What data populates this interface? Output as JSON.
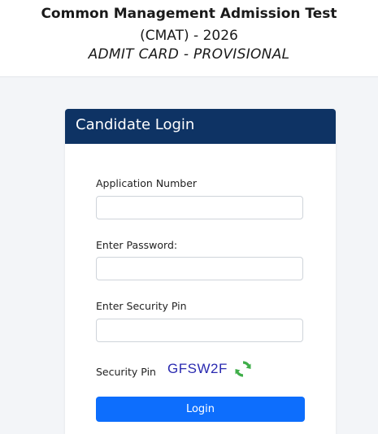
{
  "header": {
    "title": "Common Management Admission Test",
    "subtitle": "(CMAT) - 2026",
    "doc_type": "ADMIT CARD - PROVISIONAL"
  },
  "login": {
    "heading": "Candidate Login",
    "application_label": "Application Number",
    "application_value": "",
    "password_label": "Enter Password:",
    "password_value": "",
    "security_input_label": "Enter Security Pin",
    "security_input_value": "",
    "security_pin_label": "Security Pin",
    "security_pin_code": "GFSW2F",
    "refresh_icon": "refresh-icon",
    "button_label": "Login"
  },
  "colors": {
    "header_bg": "#ffffff",
    "page_bg": "#f3f5f8",
    "card_header_bg": "#0e3364",
    "button_bg": "#0d6efd",
    "captcha_text": "#2a2ab0",
    "refresh_icon": "#3fae49"
  }
}
